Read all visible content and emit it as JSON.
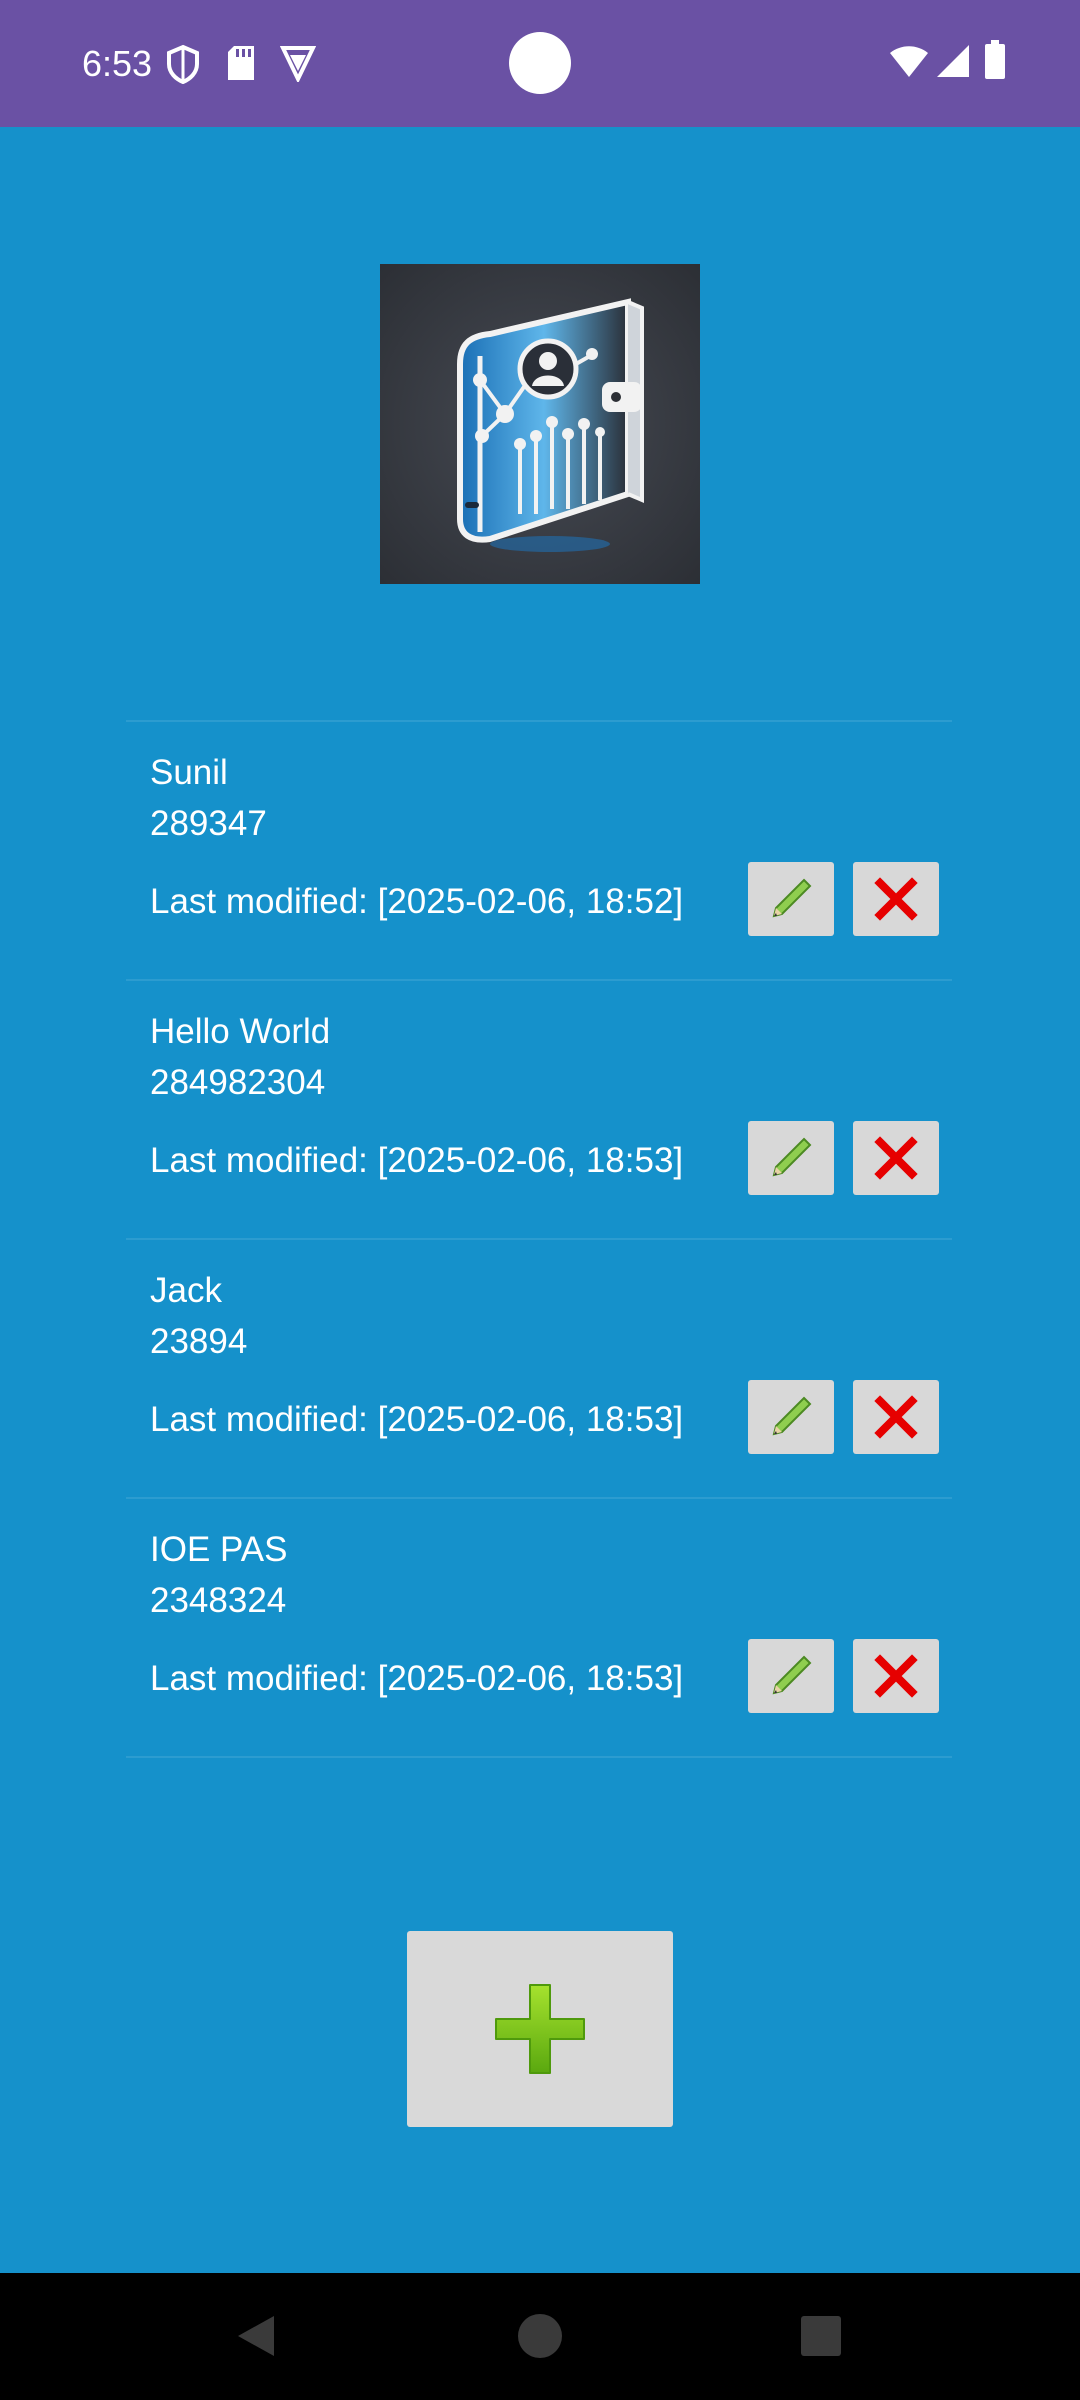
{
  "status_bar": {
    "time": "6:53",
    "icons": [
      "shield-icon",
      "sd-card-icon",
      "vpn-icon",
      "wifi-icon",
      "signal-icon",
      "battery-icon"
    ],
    "background": "#6a51a4"
  },
  "app": {
    "background": "#1591cb",
    "logo": "contact-book-logo"
  },
  "contacts": [
    {
      "name": "Sunil",
      "number": "289347",
      "modified": "Last modified: [2025-02-06, 18:52]"
    },
    {
      "name": "Hello World",
      "number": "284982304",
      "modified": "Last modified: [2025-02-06, 18:53]"
    },
    {
      "name": "Jack",
      "number": "23894",
      "modified": "Last modified: [2025-02-06, 18:53]"
    },
    {
      "name": "IOE PAS",
      "number": "2348324",
      "modified": "Last modified: [2025-02-06, 18:53]"
    }
  ],
  "actions": {
    "edit_icon": "pencil-icon",
    "delete_icon": "red-x-icon",
    "add_icon": "green-plus-icon"
  },
  "nav_bar": {
    "buttons": [
      "back-icon",
      "home-icon",
      "recents-icon"
    ]
  }
}
